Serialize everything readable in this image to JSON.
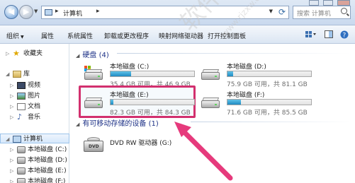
{
  "address": {
    "location": "计算机",
    "search_placeholder": "搜索 计算机"
  },
  "toolbar": {
    "items": [
      "组织",
      "属性",
      "系统属性",
      "卸载或更改程序",
      "映射网络驱动器",
      "打开控制面板"
    ]
  },
  "nav": {
    "favorites": "收藏夹",
    "library": "库",
    "library_items": [
      "视频",
      "图片",
      "文档",
      "音乐"
    ],
    "computer": "计算机",
    "computer_items": [
      "本地磁盘 (C:)",
      "本地磁盘 (D:)",
      "本地磁盘 (E:)",
      "本地磁盘 (F:)"
    ]
  },
  "groups": {
    "hard_disks": "硬盘 (4)",
    "removable": "有可移动存储的设备 (1)"
  },
  "drives": [
    {
      "name": "本地磁盘 (C:)",
      "info": "35.4 GB 可用，共 46.9 GB",
      "used_fraction": 0.245,
      "system": true,
      "bar_color": "#26a0da"
    },
    {
      "name": "本地磁盘 (D:)",
      "info": "75.9 GB 可用，共 81.1 GB",
      "used_fraction": 0.064,
      "system": false,
      "bar_color": "#26a0da"
    },
    {
      "name": "本地磁盘 (E:)",
      "info": "82.3 GB 可用，共 84.3 GB",
      "used_fraction": 0.024,
      "system": false,
      "bar_color": "#26a0da"
    },
    {
      "name": "本地磁盘 (F:)",
      "info": "71.6 GB 可用，共 85.5 GB",
      "used_fraction": 0.163,
      "system": false,
      "bar_color": "#26a0da"
    }
  ],
  "dvd": {
    "name": "DVD RW 驱动器 (G:)",
    "logo": "DVD"
  },
  "colors": {
    "highlight": "#d2306e",
    "accent": "#1e3287"
  },
  "watermark": {
    "main": "软件自学网",
    "sub": "www.rjzxw.com"
  }
}
